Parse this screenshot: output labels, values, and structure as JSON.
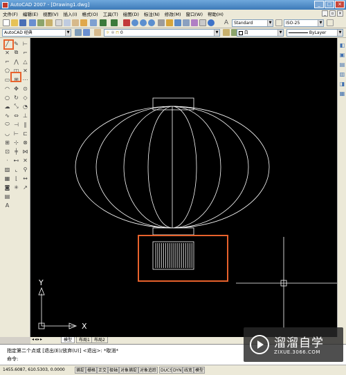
{
  "window": {
    "title": "AutoCAD 2007 - [Drawing1.dwg]",
    "min": "_",
    "max": "□",
    "close": "×"
  },
  "menu": [
    "文件(F)",
    "编辑(E)",
    "视图(V)",
    "插入(I)",
    "格式(O)",
    "工具(T)",
    "绘图(D)",
    "标注(N)",
    "修改(M)",
    "窗口(W)",
    "帮助(H)"
  ],
  "toolbar": {
    "text_style": "Standard",
    "dim_style": "ISO-25",
    "workspace": "AutoCAD 经典",
    "layer": "0",
    "color": "白",
    "linetype": "ByLayer"
  },
  "ucs": {
    "x_label": "X",
    "y_label": "Y"
  },
  "tabs": [
    "模型",
    "布局1",
    "布局2"
  ],
  "command": {
    "line1": "指定第二个点或 [退出(E)/放弃(U)] <退出>:  *取消*",
    "line2": "命令:"
  },
  "status": {
    "coords": "1455.6087, 610.5303, 0.0000",
    "buttons": [
      "捕捉",
      "栅格",
      "正交",
      "极轴",
      "对象捕捉",
      "对象追踪",
      "DUCS",
      "DYN",
      "线宽",
      "模型"
    ]
  },
  "watermark": {
    "brand": "溜溜自学",
    "url": "ZIXUE.3066.COM"
  },
  "colors": {
    "highlight": "#e8622c",
    "canvas": "#000000",
    "drawing": "#ffffff"
  }
}
